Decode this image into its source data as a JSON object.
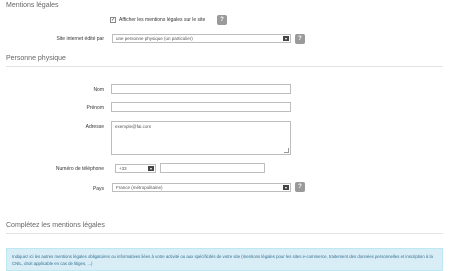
{
  "mentions": {
    "section_title": "Mentions légales",
    "checkbox_label": "Afficher les mentions légales sur le site",
    "checkbox_checked": true,
    "edited_by_label": "Site internet édité par",
    "edited_by_value": "une personne physique (un particulier)"
  },
  "personne": {
    "section_title": "Personne physique",
    "nom_label": "Nom",
    "nom_value": "",
    "prenom_label": "Prénom",
    "prenom_value": "",
    "adresse_label": "Adresse",
    "adresse_value": "exemple@fai.com",
    "phone_label": "Numéro de téléphone",
    "phone_prefix": "+33",
    "phone_value": "",
    "pays_label": "Pays",
    "pays_value": "France (métropolitaine)"
  },
  "completez": {
    "section_title": "Complétez les mentions légales",
    "info_text": "Indiquez ici les autres mentions légales obligatoires ou informatives liées à votre activité ou aux spécificités de votre site (mentions légales pour les sites e-commerce, traitement des données personnelles et inscription à la CNIL, droit applicable en cas de litiges, ...)"
  },
  "icons": {
    "help": "?",
    "check": "✓",
    "dropdown": "▾"
  },
  "colors": {
    "info_bg": "#d9edf7",
    "info_text": "#31708f",
    "help_bg": "#9a9a9a"
  }
}
